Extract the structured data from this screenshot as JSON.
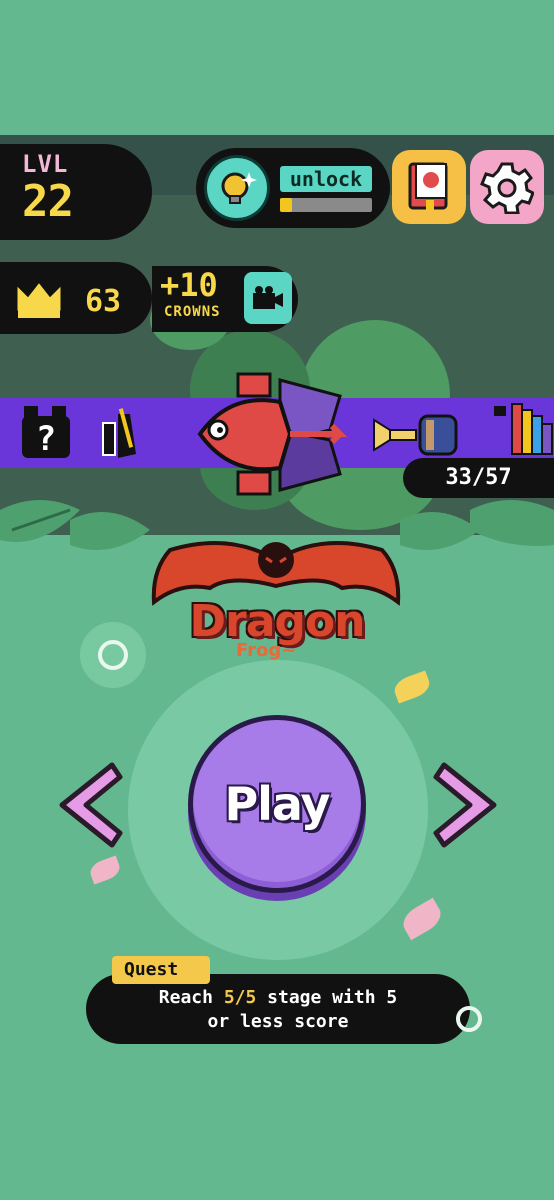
{
  "level": {
    "label": "LVL",
    "value": "22"
  },
  "unlock": {
    "label": "unlock",
    "progress": 0.13
  },
  "crowns": {
    "value": "63",
    "bonus": "+10",
    "bonus_label": "CROWNS"
  },
  "collection": {
    "counter": "33/57"
  },
  "character": {
    "name": "Dragon",
    "subname": "Frog~"
  },
  "play": {
    "label": "Play"
  },
  "quest": {
    "tag": "Quest",
    "line1_a": "Reach ",
    "line1_hl": "5/5",
    "line1_b": " stage with 5",
    "line2": "or less score"
  },
  "icons": [
    "lightbulb-icon",
    "book-icon",
    "gear-icon",
    "crown-icon",
    "camera-icon",
    "mystery-icon",
    "left-arrow-icon",
    "right-arrow-icon",
    "target-icon"
  ],
  "colors": {
    "background": "#64b88f",
    "band": "#6b36d9",
    "accent_yellow": "#f7d84a",
    "play": "#a87ce8",
    "arrow": "#e59be6"
  }
}
